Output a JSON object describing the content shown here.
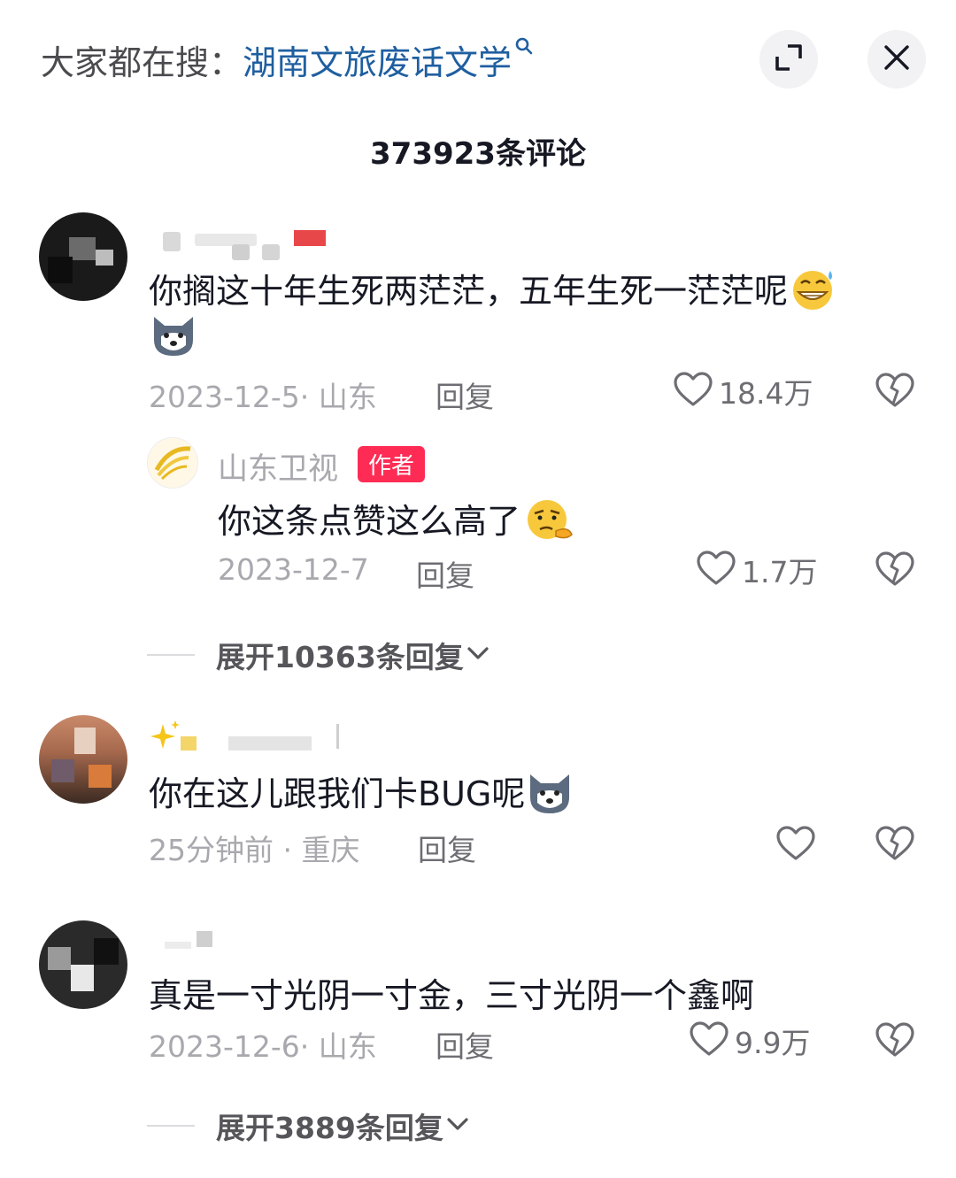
{
  "header": {
    "search_prefix": "大家都在搜：",
    "search_term": "湖南文旅废话文学",
    "comment_count": "373923条评论"
  },
  "icons": {
    "search": "search-icon",
    "expand": "expand-icon",
    "close": "close-icon",
    "like": "heart-icon",
    "dislike": "broken-heart-icon",
    "chevron": "chevron-down-icon"
  },
  "colors": {
    "accent_link": "#1f5fa0",
    "author_tag": "#fe2c55"
  },
  "comments": [
    {
      "text": "你搁这十年生死两茫茫，五年生死一茫茫呢",
      "meta": "2023-12-5· 山东",
      "reply_label": "回复",
      "likes": "18.4万",
      "reply": {
        "author": "山东卫视",
        "tag": "作者",
        "text": "你这条点赞这么高了",
        "meta": "2023-12-7",
        "reply_label": "回复",
        "likes": "1.7万"
      },
      "expand_label": "展开10363条回复"
    },
    {
      "text": "你在这儿跟我们卡BUG呢",
      "meta": "25分钟前 · 重庆",
      "reply_label": "回复",
      "likes": ""
    },
    {
      "text": "真是一寸光阴一寸金，三寸光阴一个鑫啊",
      "meta": "2023-12-6· 山东",
      "reply_label": "回复",
      "likes": "9.9万",
      "expand_label": "展开3889条回复"
    }
  ]
}
